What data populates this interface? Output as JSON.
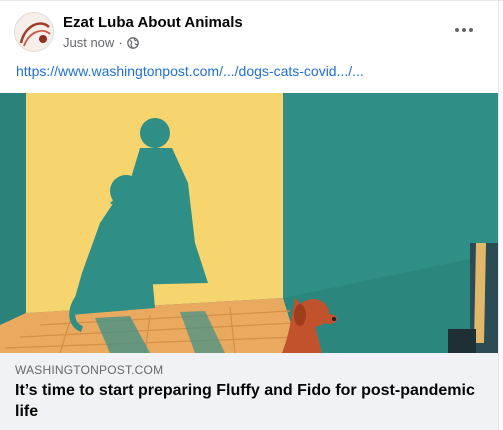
{
  "post": {
    "page_name": "Ezat Luba About Animals",
    "timestamp": "Just now",
    "separator": "·",
    "privacy_icon": "globe-icon",
    "more_icon": "more-dots-icon",
    "link_text": "https://www.washingtonpost.com/.../dogs-cats-covid.../..."
  },
  "preview": {
    "source": "WASHINGTONPOST.COM",
    "headline": "It’s time to start preparing Fluffy and Fido for post-pandemic life"
  },
  "colors": {
    "link": "#216fdb",
    "wall_yellow": "#f6d56e",
    "wall_teal": "#2f8f86",
    "floor_wood": "#e9a95e",
    "dog_red": "#c2522c"
  }
}
